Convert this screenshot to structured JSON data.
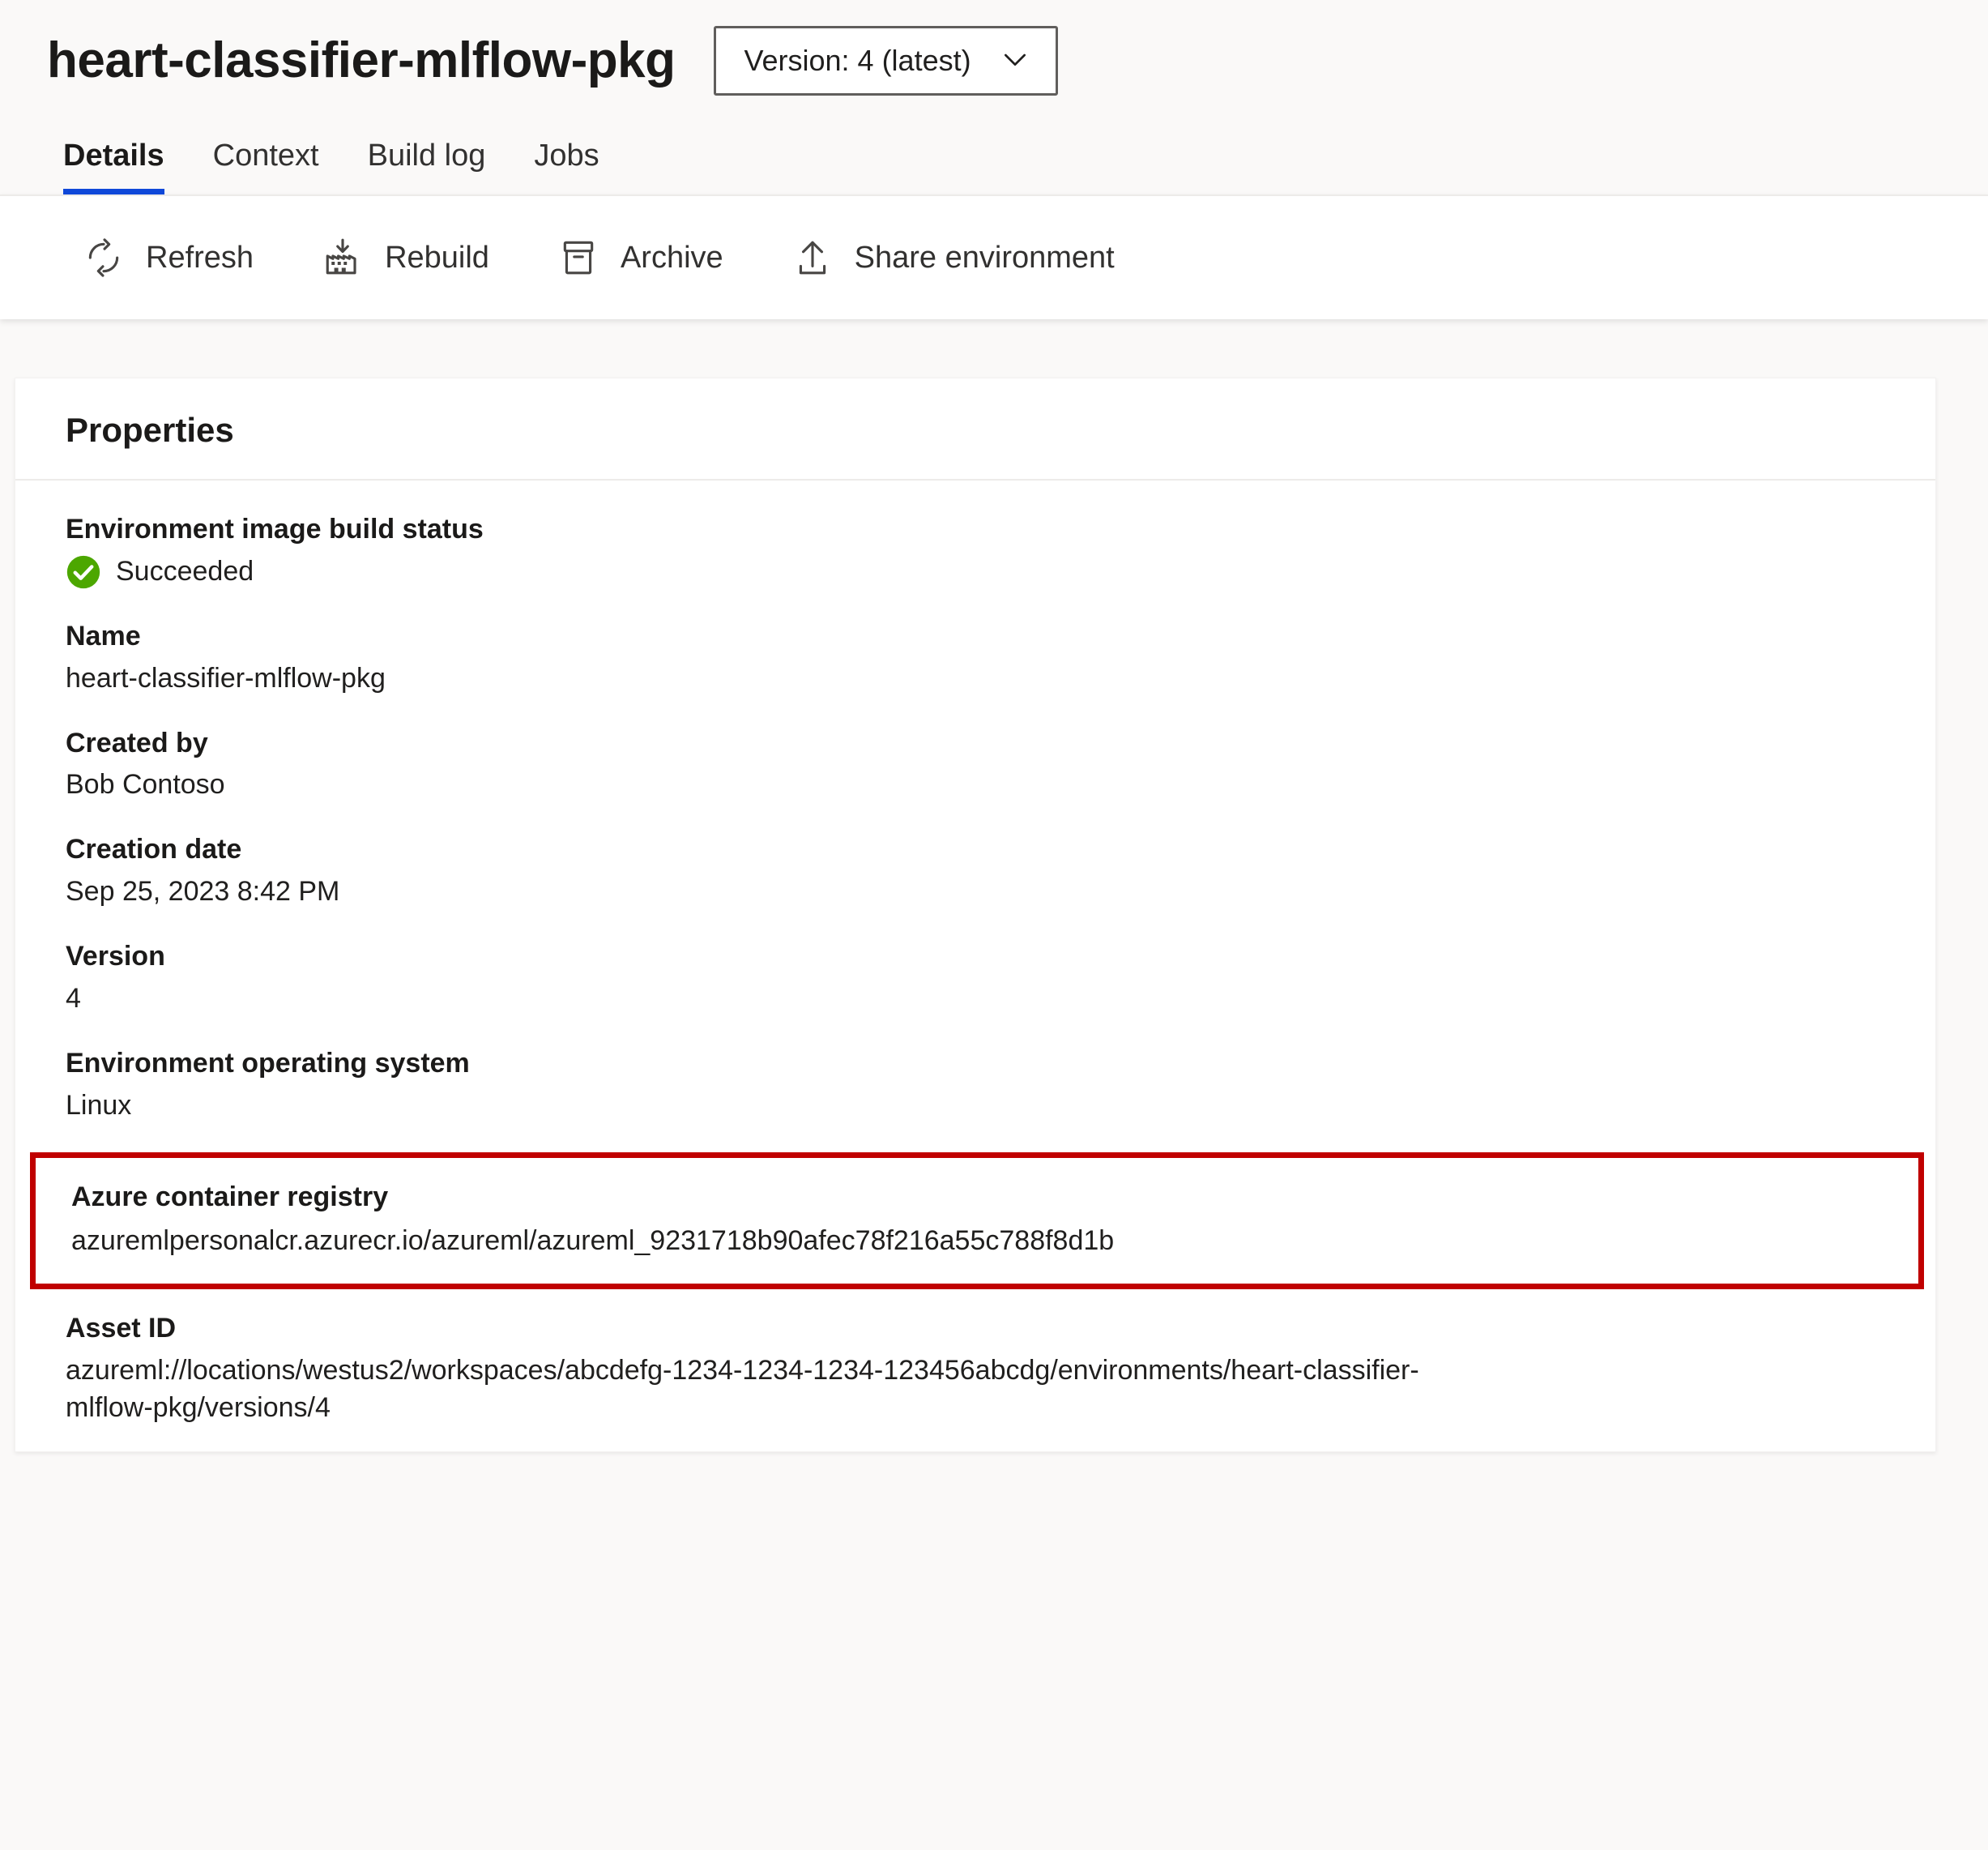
{
  "header": {
    "title": "heart-classifier-mlflow-pkg",
    "version_selector": {
      "label": "Version: 4 (latest)",
      "icon": "chevron-down-icon"
    }
  },
  "tabs": [
    {
      "label": "Details",
      "active": true
    },
    {
      "label": "Context",
      "active": false
    },
    {
      "label": "Build log",
      "active": false
    },
    {
      "label": "Jobs",
      "active": false
    }
  ],
  "toolbar": [
    {
      "label": "Refresh",
      "icon": "refresh-icon"
    },
    {
      "label": "Rebuild",
      "icon": "rebuild-icon"
    },
    {
      "label": "Archive",
      "icon": "archive-icon"
    },
    {
      "label": "Share environment",
      "icon": "share-upload-icon"
    }
  ],
  "properties_card": {
    "title": "Properties",
    "items": [
      {
        "label": "Environment image build status",
        "value": "Succeeded",
        "icon": "success-check-icon",
        "status_color": "#4CA700"
      },
      {
        "label": "Name",
        "value": "heart-classifier-mlflow-pkg"
      },
      {
        "label": "Created by",
        "value": "Bob Contoso"
      },
      {
        "label": "Creation date",
        "value": "Sep 25, 2023 8:42 PM"
      },
      {
        "label": "Version",
        "value": "4"
      },
      {
        "label": "Environment operating system",
        "value": "Linux"
      },
      {
        "label": "Azure container registry",
        "value": "azuremlpersonalcr.azurecr.io/azureml/azureml_9231718b90afec78f216a55c788f8d1b",
        "highlighted": true
      },
      {
        "label": "Asset ID",
        "value": "azureml://locations/westus2/workspaces/abcdefg-1234-1234-1234-123456abcdg/environments/heart-classifier-mlflow-pkg/versions/4"
      }
    ]
  },
  "colors": {
    "accent": "#0f48d9",
    "highlight_box": "#c00000",
    "success_green": "#4CA700",
    "page_background": "#faf9f8",
    "card_background": "#ffffff"
  }
}
